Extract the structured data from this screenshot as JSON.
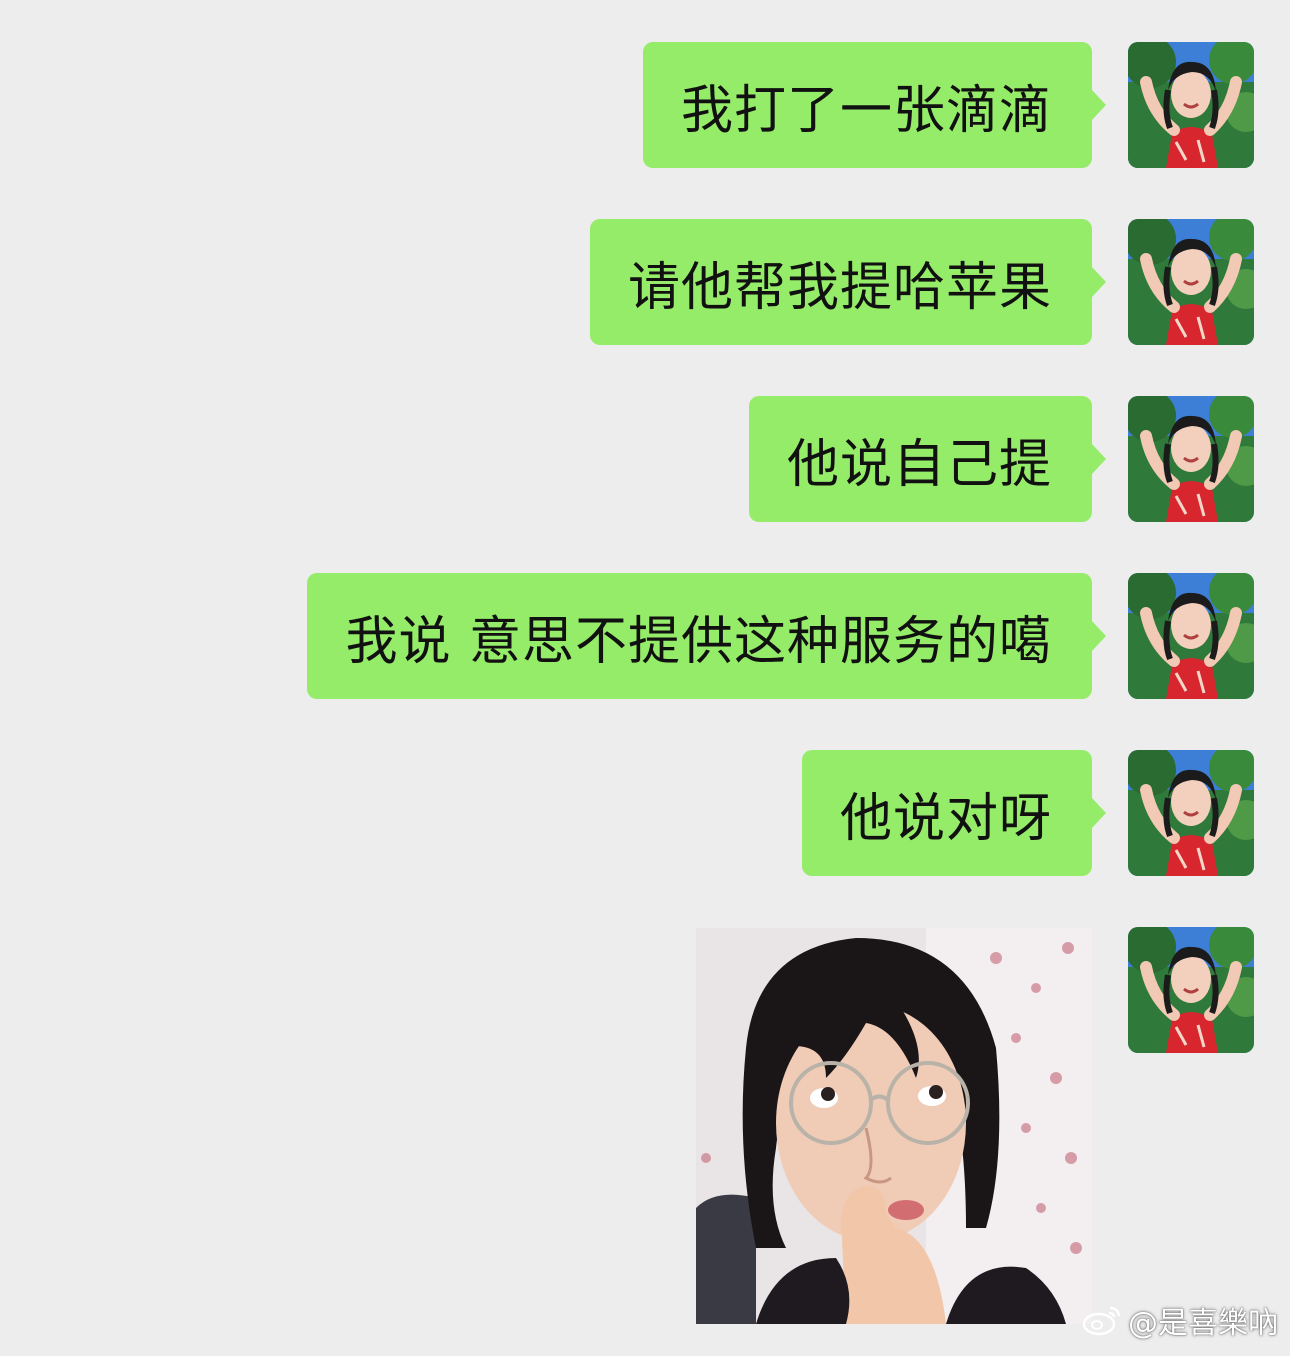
{
  "chat": {
    "messages": [
      {
        "text": "我打了一张滴滴"
      },
      {
        "text": "请他帮我提哈苹果"
      },
      {
        "text": "他说自己提"
      },
      {
        "text": "我说 意思不提供这种服务的噶"
      },
      {
        "text": "他说对呀"
      }
    ],
    "sticker": {
      "icon": "girl-finger-on-lip-sticker"
    },
    "avatar_icon": "avatar-girl-red-dress"
  },
  "watermark": {
    "text": "@是喜樂吶",
    "logo_icon": "weibo-logo-icon"
  },
  "colors": {
    "background": "#ededed",
    "bubble": "#95ec69",
    "text": "#111111"
  }
}
